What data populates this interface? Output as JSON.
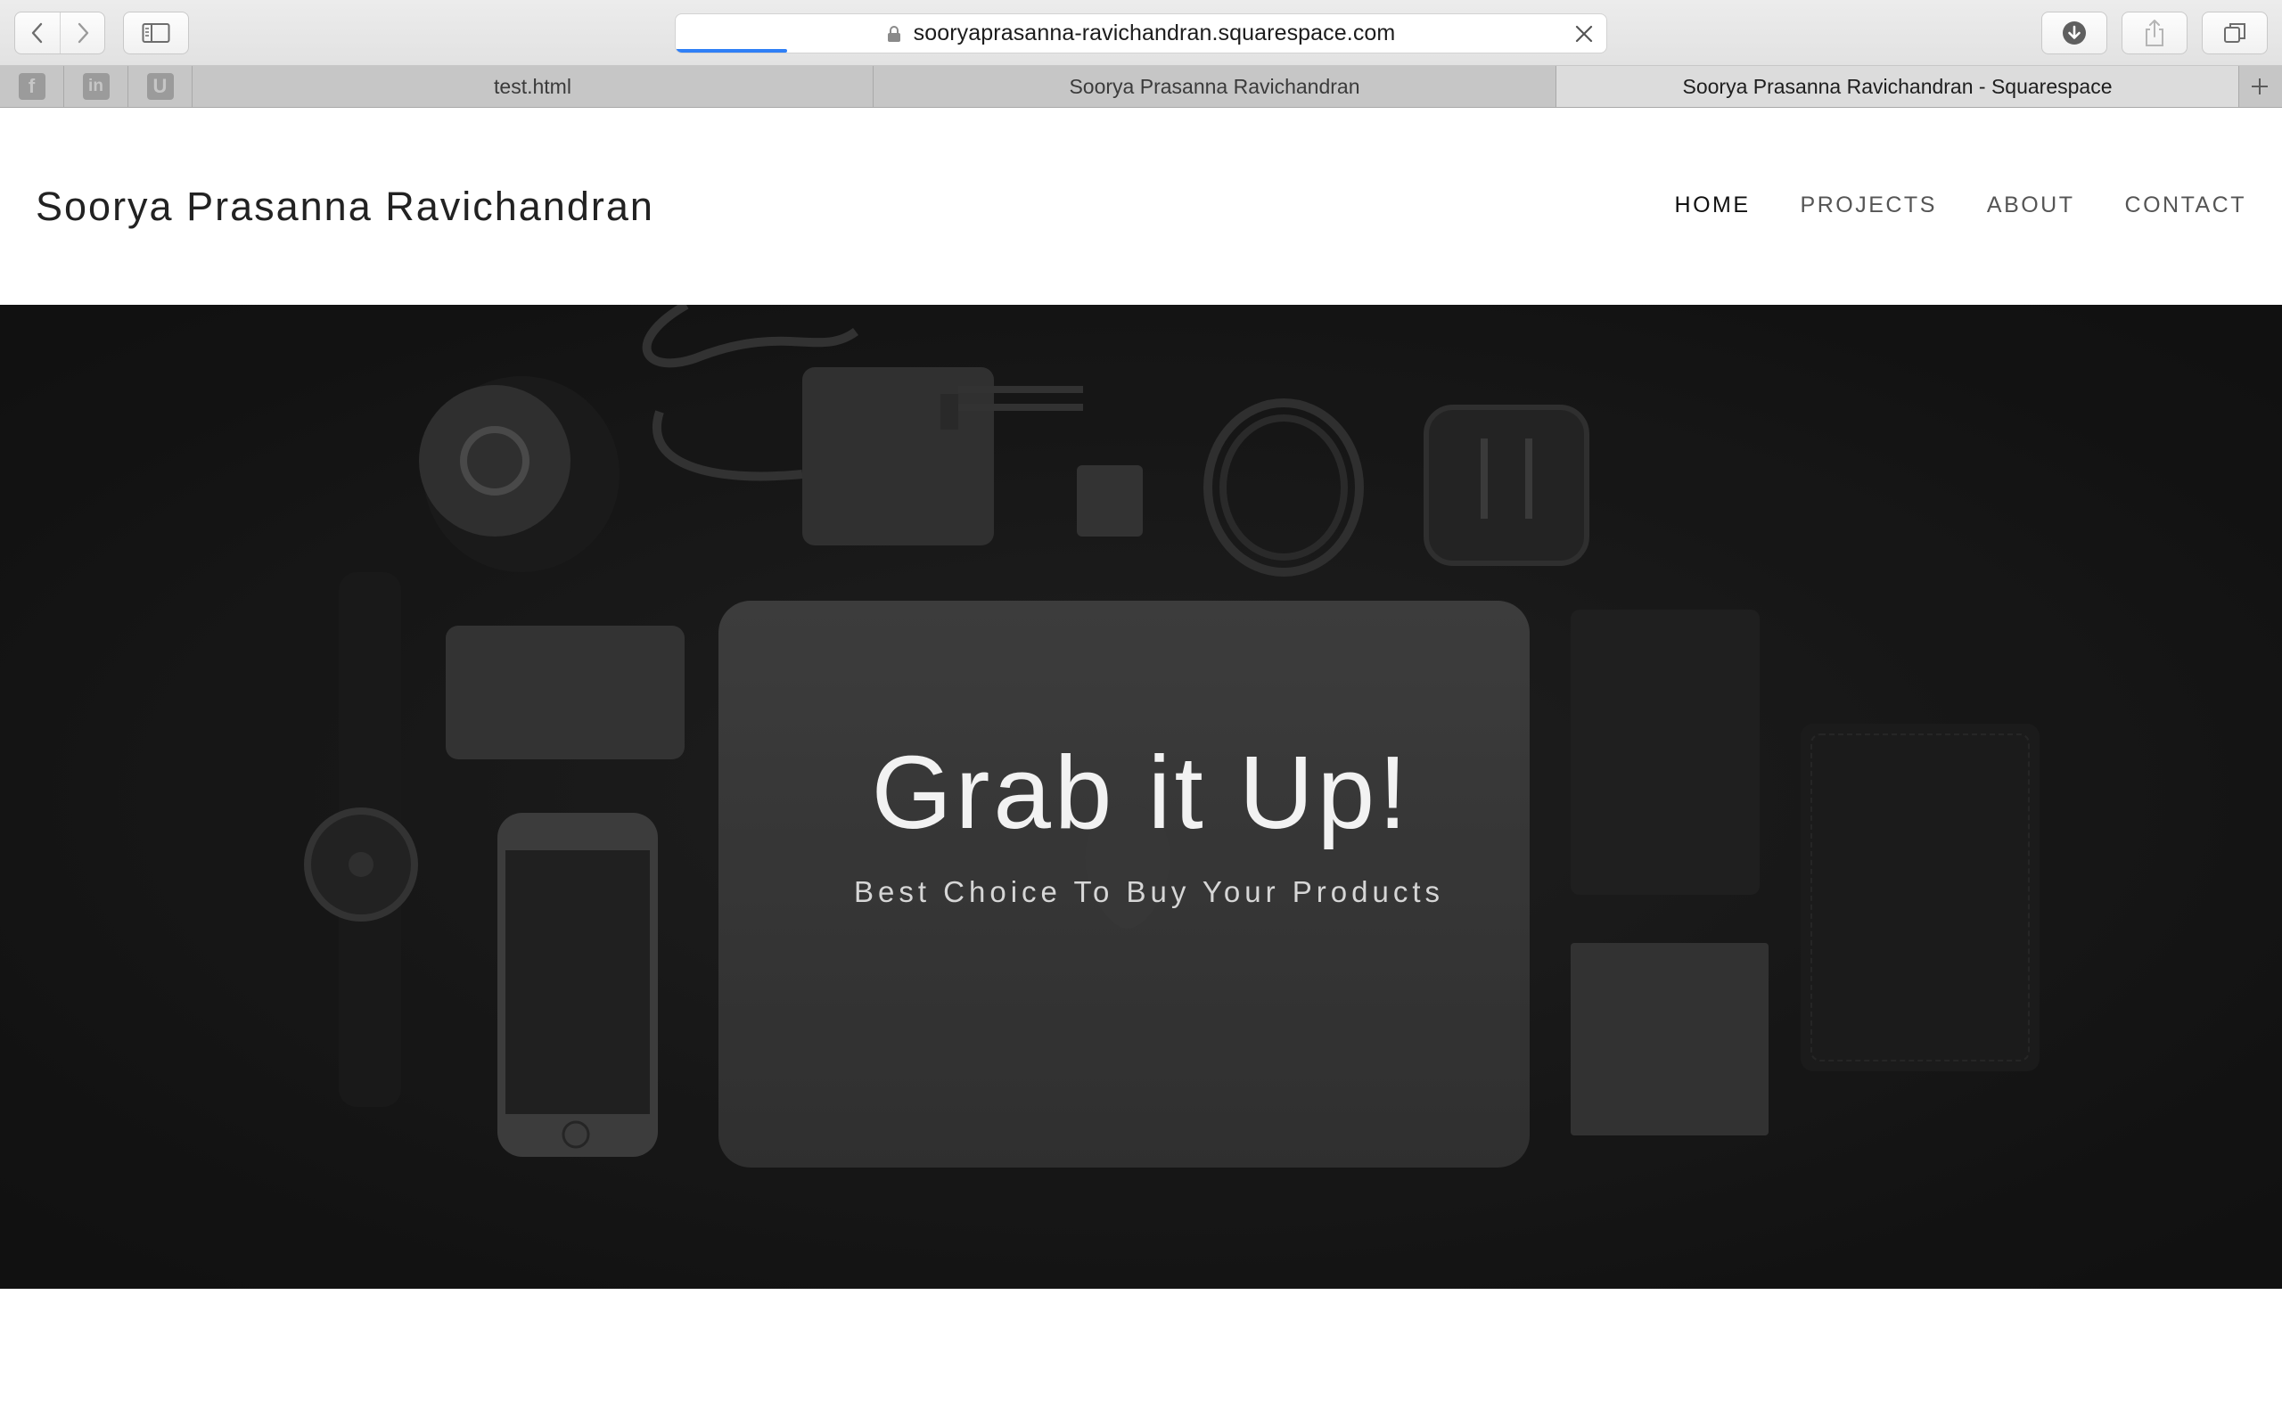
{
  "browser": {
    "address": "sooryaprasanna-ravichandran.squarespace.com",
    "pinned_tabs": [
      {
        "icon": "facebook-icon",
        "glyph": "f"
      },
      {
        "icon": "linkedin-icon",
        "glyph": "in"
      },
      {
        "icon": "upwork-icon",
        "glyph": "U"
      }
    ],
    "tabs": [
      {
        "title": "test.html",
        "active": false
      },
      {
        "title": "Soorya Prasanna Ravichandran",
        "active": false
      },
      {
        "title": "Soorya Prasanna Ravichandran - Squarespace",
        "active": true
      }
    ],
    "page_load_progress": 0.12
  },
  "site": {
    "title": "Soorya Prasanna Ravichandran",
    "nav": [
      {
        "label": "HOME",
        "active": true
      },
      {
        "label": "PROJECTS",
        "active": false
      },
      {
        "label": "ABOUT",
        "active": false
      },
      {
        "label": "CONTACT",
        "active": false
      }
    ]
  },
  "hero": {
    "title": "Grab it Up!",
    "subtitle": "Best Choice To Buy Your Products"
  },
  "colors": {
    "hero_background": "#1b1b1b",
    "accent_progress": "#2f7ff6"
  }
}
